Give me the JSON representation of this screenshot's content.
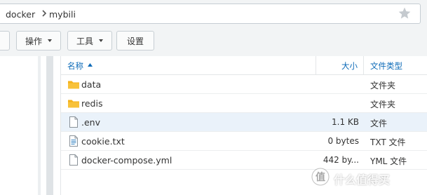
{
  "breadcrumb": {
    "items": [
      "docker",
      "mybili"
    ]
  },
  "toolbar": {
    "action_label": "操作",
    "tools_label": "工具",
    "settings_label": "设置"
  },
  "columns": {
    "name": "名称",
    "size": "大小",
    "type": "文件类型"
  },
  "files": [
    {
      "name": "data",
      "size": "",
      "type": "文件夹",
      "icon": "folder-icon"
    },
    {
      "name": "redis",
      "size": "",
      "type": "文件夹",
      "icon": "folder-icon"
    },
    {
      "name": ".env",
      "size": "1.1 KB",
      "type": "文件",
      "icon": "file-icon"
    },
    {
      "name": "cookie.txt",
      "size": "0 bytes",
      "type": "TXT 文件",
      "icon": "text-file-icon"
    },
    {
      "name": "docker-compose.yml",
      "size": "442 by...",
      "type": "YML 文件",
      "icon": "file-icon"
    }
  ],
  "watermark": {
    "text": "什么值得买"
  },
  "colors": {
    "accent": "#0d6bb8",
    "folder": "#f5b21b",
    "highlight_row": "#eaf2fa",
    "toolbar_bg": "#f2f4f5"
  }
}
